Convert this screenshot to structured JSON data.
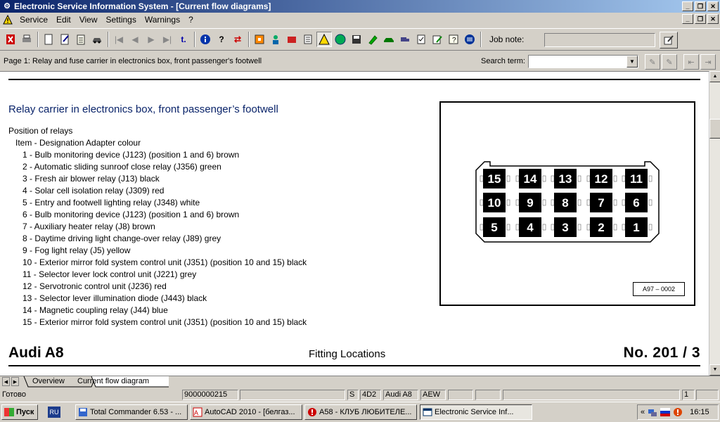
{
  "window": {
    "title": "Electronic Service Information System - [Current flow diagrams]"
  },
  "menu": [
    "Service",
    "Edit",
    "View",
    "Settings",
    "Warnings",
    "?"
  ],
  "toolbar": {
    "job_note_label": "Job note:",
    "job_note_value": ""
  },
  "page_header": {
    "text": "Page 1: Relay and fuse carrier in electronics box, front passenger's footwell",
    "search_label": "Search term:",
    "search_value": ""
  },
  "document": {
    "title": "Relay carrier in electronics box, front passenger’s footwell",
    "subtitle": "Position of relays",
    "header_line": "Item - Designation Adapter colour",
    "items": [
      "1 - Bulb monitoring device (J123) (position 1 and 6) brown",
      "2 - Automatic sliding sunroof close relay (J356) green",
      "3 - Fresh air blower relay (J13) black",
      "4 - Solar cell isolation relay (J309) red",
      "5 - Entry and footwell lighting relay (J348) white",
      "6 - Bulb monitoring device (J123) (position 1 and 6) brown",
      "7 - Auxiliary heater relay (J8) brown",
      "8 - Daytime driving light change-over relay (J89) grey",
      "9 - Fog light relay (J5) yellow",
      "10 - Exterior mirror fold system control unit (J351) (position 10 and 15) black",
      "11 - Selector lever lock control unit (J221) grey",
      "12 - Servotronic control unit (J236) red",
      "13 - Selector lever illumination diode (J443) black",
      "14 - Magnetic coupling relay (J44) blue",
      "15 - Exterior mirror fold system control unit (J351) (position 10 and 15) black"
    ],
    "figure": {
      "row1": [
        "15",
        "14",
        "13",
        "12",
        "11"
      ],
      "row2": [
        "10",
        "9",
        "8",
        "7",
        "6"
      ],
      "row3": [
        "5",
        "4",
        "3",
        "2",
        "1"
      ],
      "code": "A97 – 0002"
    },
    "footer_left": "Audi A8",
    "footer_mid": "Fitting Locations",
    "footer_right": "No.  201 / 3"
  },
  "tabs": [
    "Overview",
    "Current flow diagram"
  ],
  "status": {
    "ready": "Готово",
    "order": "9000000215",
    "s": "S",
    "code": "4D2",
    "model": "Audi A8",
    "engine": "AEW",
    "page": "1"
  },
  "taskbar": {
    "start": "Пуск",
    "lang": "RU",
    "tasks": [
      "Total Commander 6.53 - ...",
      "AutoCAD 2010 - [белгаз...",
      "A58 - КЛУБ ЛЮБИТЕЛЕ...",
      "Electronic Service Inf..."
    ],
    "clock": "16:15"
  }
}
